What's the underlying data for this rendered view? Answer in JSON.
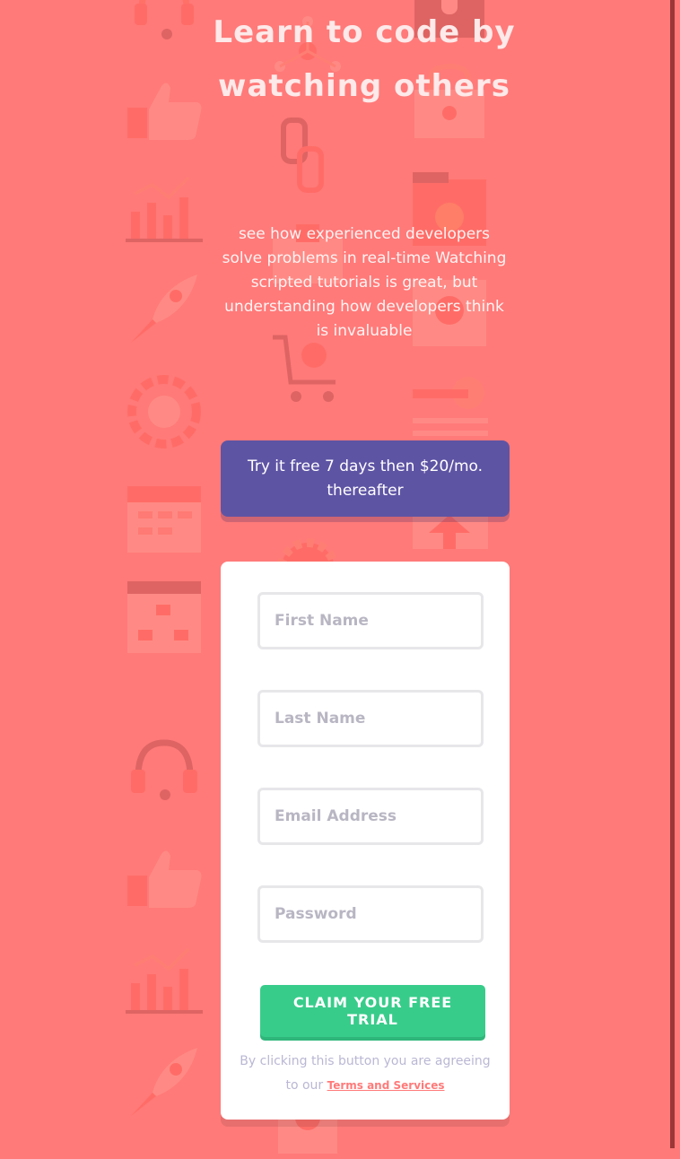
{
  "hero": {
    "title": "Learn to code by watching others",
    "subtitle": "see how experienced developers solve problems in real-time Watching scripted tutorials is great, but understanding how developers think is invaluable"
  },
  "banner": {
    "text": "Try it free 7 days then $20/mo. thereafter"
  },
  "form": {
    "first_name": {
      "placeholder": "First Name",
      "value": ""
    },
    "last_name": {
      "placeholder": "Last Name",
      "value": ""
    },
    "email": {
      "placeholder": "Email Address",
      "value": ""
    },
    "password": {
      "placeholder": "Password",
      "value": ""
    },
    "submit_label": "CLAIM YOUR FREE TRIAL",
    "terms_prefix": "By clicking this button you are agreeing to our ",
    "terms_link": "Terms and Services"
  },
  "colors": {
    "background": "#ff7a79",
    "banner": "#5e54a4",
    "cta": "#38cc8b",
    "card": "#ffffff"
  },
  "background_icons": [
    "thumbs-up-icon",
    "bar-chart-icon",
    "rocket-icon",
    "globe-gear-icon",
    "calendar-icon",
    "browser-flowchart-icon",
    "headset-icon",
    "lock-icon",
    "folder-gear-icon",
    "key-icon",
    "house-icon",
    "atom-icon",
    "chain-link-icon",
    "cart-gear-icon"
  ]
}
